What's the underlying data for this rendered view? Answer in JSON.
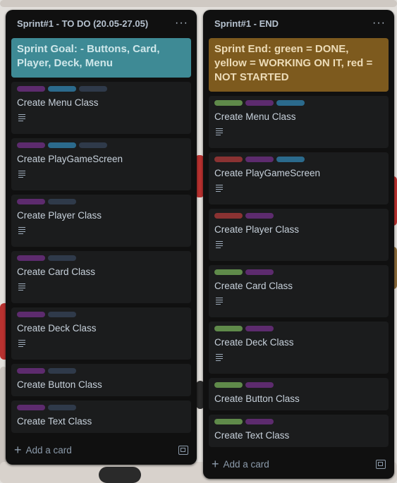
{
  "colors": {
    "label_purple": "#5d2b6e",
    "label_blue": "#2b6a8c",
    "label_slate": "#2f3a4a",
    "label_green": "#5f8a4a",
    "label_red": "#8a3232",
    "goal_teal": "#3e8a95",
    "goal_ochre": "#7d5a1e"
  },
  "lists": {
    "todo": {
      "title": "Sprint#1 - TO DO (20.05-27.05)",
      "more": "···",
      "goal": "Sprint Goal: - Buttons, Card, Player, Deck, Menu",
      "add_card": "Add a card",
      "cards": [
        {
          "title": "Create Menu Class",
          "labels": [
            "purple",
            "blue",
            "slate"
          ],
          "has_desc": true
        },
        {
          "title": "Create PlayGameScreen",
          "labels": [
            "purple",
            "blue",
            "slate"
          ],
          "has_desc": true
        },
        {
          "title": "Create Player Class",
          "labels": [
            "purple",
            "slate"
          ],
          "has_desc": true
        },
        {
          "title": "Create Card Class",
          "labels": [
            "purple",
            "slate"
          ],
          "has_desc": true
        },
        {
          "title": "Create Deck Class",
          "labels": [
            "purple",
            "slate"
          ],
          "has_desc": true
        },
        {
          "title": "Create Button Class",
          "labels": [
            "purple",
            "slate"
          ],
          "has_desc": false
        },
        {
          "title": "Create Text Class",
          "labels": [
            "purple",
            "slate"
          ],
          "has_desc": false
        }
      ]
    },
    "end": {
      "title": "Sprint#1 - END",
      "more": "···",
      "goal": "Sprint End: green = DONE, yellow = WORKING ON IT, red = NOT STARTED",
      "add_card": "Add a card",
      "cards": [
        {
          "title": "Create Menu Class",
          "labels": [
            "green",
            "purple",
            "blue"
          ],
          "has_desc": true
        },
        {
          "title": "Create PlayGameScreen",
          "labels": [
            "red",
            "purple",
            "blue"
          ],
          "has_desc": true
        },
        {
          "title": "Create Player Class",
          "labels": [
            "red",
            "purple"
          ],
          "has_desc": true
        },
        {
          "title": "Create Card Class",
          "labels": [
            "green",
            "purple"
          ],
          "has_desc": true
        },
        {
          "title": "Create Deck Class",
          "labels": [
            "green",
            "purple"
          ],
          "has_desc": true
        },
        {
          "title": "Create Button Class",
          "labels": [
            "green",
            "purple"
          ],
          "has_desc": false
        },
        {
          "title": "Create Text Class",
          "labels": [
            "green",
            "purple"
          ],
          "has_desc": false
        }
      ]
    }
  }
}
